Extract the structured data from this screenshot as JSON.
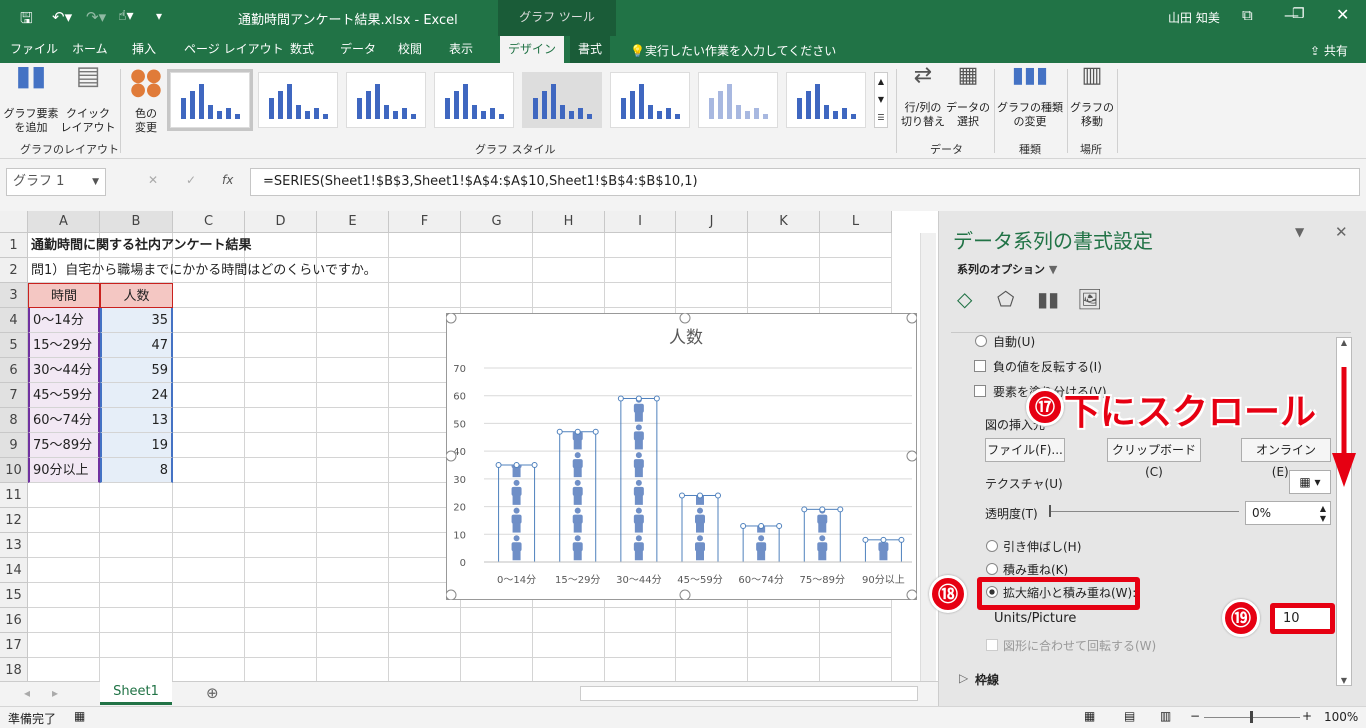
{
  "titlebar": {
    "filename": "通勤時間アンケート結果.xlsx  -  Excel",
    "context_tab": "グラフ ツール",
    "user": "山田 知美"
  },
  "tabs": [
    "ファイル",
    "ホーム",
    "挿入",
    "ページ レイアウト",
    "数式",
    "データ",
    "校閲",
    "表示",
    "デザイン",
    "書式"
  ],
  "active_tab": "デザイン",
  "tell_me": "実行したい作業を入力してください",
  "share": "共有",
  "ribbon": {
    "add_element": "グラフ要素\nを追加",
    "quick_layout": "クイック\nレイアウト",
    "layout_group": "グラフのレイアウト",
    "change_colors": "色の\n変更",
    "style_group": "グラフ スタイル",
    "switch_row_col": "行/列の\n切り替え",
    "select_data": "データの\n選択",
    "data_group": "データ",
    "change_type": "グラフの種類\nの変更",
    "type_group": "種類",
    "move_chart": "グラフの\n移動",
    "location_group": "場所"
  },
  "formula": {
    "name_box": "グラフ 1",
    "fx": "fx",
    "content": "=SERIES(Sheet1!$B$3,Sheet1!$A$4:$A$10,Sheet1!$B$4:$B$10,1)"
  },
  "columns": [
    "A",
    "B",
    "C",
    "D",
    "E",
    "F",
    "G",
    "H",
    "I",
    "J",
    "K",
    "L"
  ],
  "rows": [
    "1",
    "2",
    "3",
    "4",
    "5",
    "6",
    "7",
    "8",
    "9",
    "10",
    "11",
    "12",
    "13",
    "14",
    "15",
    "16",
    "17",
    "18"
  ],
  "sheet": {
    "title": "通勤時間に関する社内アンケート結果",
    "question": "問1）自宅から職場までにかかる時間はどのくらいですか。",
    "headers": [
      "時間",
      "人数"
    ],
    "table": [
      [
        "0〜14分",
        "35"
      ],
      [
        "15〜29分",
        "47"
      ],
      [
        "30〜44分",
        "59"
      ],
      [
        "45〜59分",
        "24"
      ],
      [
        "60〜74分",
        "13"
      ],
      [
        "75〜89分",
        "19"
      ],
      [
        "90分以上",
        "8"
      ]
    ]
  },
  "chart_data": {
    "type": "bar",
    "title": "人数",
    "categories": [
      "0〜14分",
      "15〜29分",
      "30〜44分",
      "45〜59分",
      "60〜74分",
      "75〜89分",
      "90分以上"
    ],
    "values": [
      35,
      47,
      59,
      24,
      13,
      19,
      8
    ],
    "ylim": [
      0,
      70
    ],
    "yticks": [
      "0",
      "10",
      "20",
      "30",
      "40",
      "50",
      "60",
      "70"
    ],
    "grid": true,
    "bar_color": "#6f8fc7",
    "fill": "stacked pictures (person icon), 10 units/picture"
  },
  "sheet_tab": "Sheet1",
  "status": "準備完了",
  "zoom": "100%",
  "panel": {
    "title": "データ系列の書式設定",
    "options": "系列のオプション",
    "auto": "自動(U)",
    "invert": "負の値を反転する(I)",
    "vary": "要素を塗り分ける(V)",
    "insert_from": "図の挿入元",
    "file_btn": "ファイル(F)...",
    "clipboard_btn": "クリップボード(C)",
    "online_btn": "オンライン(E)...",
    "texture": "テクスチャ(U)",
    "transparency": "透明度(T)",
    "transparency_value": "0%",
    "stretch": "引き伸ばし(H)",
    "stack": "積み重ね(K)",
    "stack_scale": "拡大縮小と積み重ね(W):",
    "units_label": "Units/Picture",
    "units_value": "10",
    "rotate": "図形に合わせて回転する(W)",
    "border": "枠線"
  },
  "annotations": {
    "step17": "⑰",
    "scroll_text": "下にスクロール",
    "step18": "⑱",
    "step19": "⑲"
  },
  "colors": {
    "excel_green": "#217346",
    "annotation_red": "#e60012"
  }
}
